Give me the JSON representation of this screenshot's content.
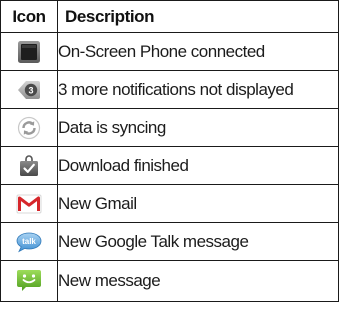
{
  "table": {
    "headers": {
      "icon": "Icon",
      "description": "Description"
    },
    "rows": [
      {
        "icon": "phone-screen-icon",
        "description": "On-Screen Phone connected"
      },
      {
        "icon": "more-notifications-icon",
        "badge": "3",
        "description": "3 more notifications not displayed"
      },
      {
        "icon": "sync-icon",
        "description": "Data is syncing"
      },
      {
        "icon": "download-finished-icon",
        "description": "Download finished"
      },
      {
        "icon": "gmail-icon",
        "description": "New Gmail"
      },
      {
        "icon": "google-talk-icon",
        "badge": "talk",
        "description": "New Google Talk message"
      },
      {
        "icon": "new-message-icon",
        "description": "New message"
      }
    ]
  }
}
